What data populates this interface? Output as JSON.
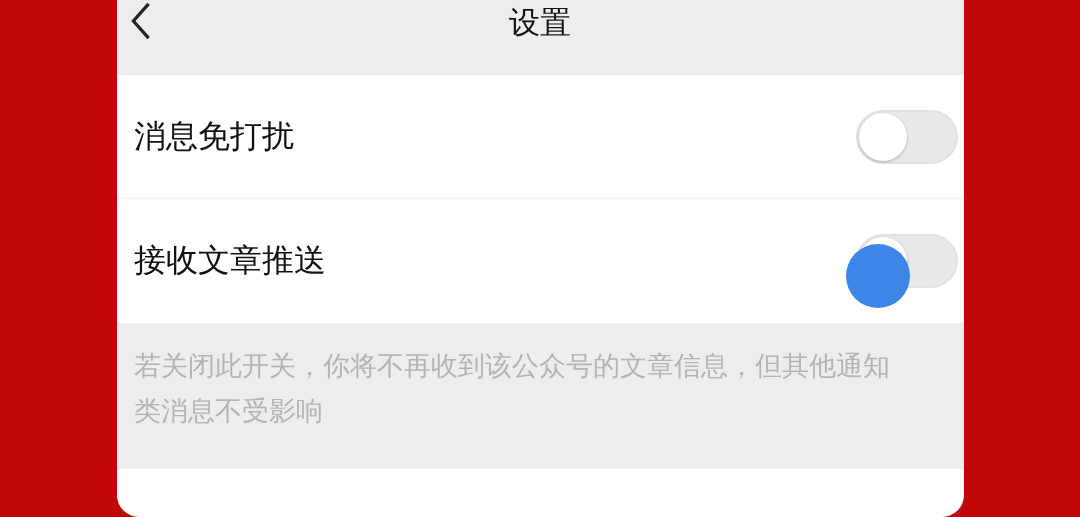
{
  "header": {
    "title": "设置"
  },
  "settings": [
    {
      "label": "消息免打扰",
      "on": false,
      "touched": false
    },
    {
      "label": "接收文章推送",
      "on": false,
      "touched": true
    }
  ],
  "note": "若关闭此开关，你将不再收到该公众号的文章信息，但其他通知类消息不受影响"
}
